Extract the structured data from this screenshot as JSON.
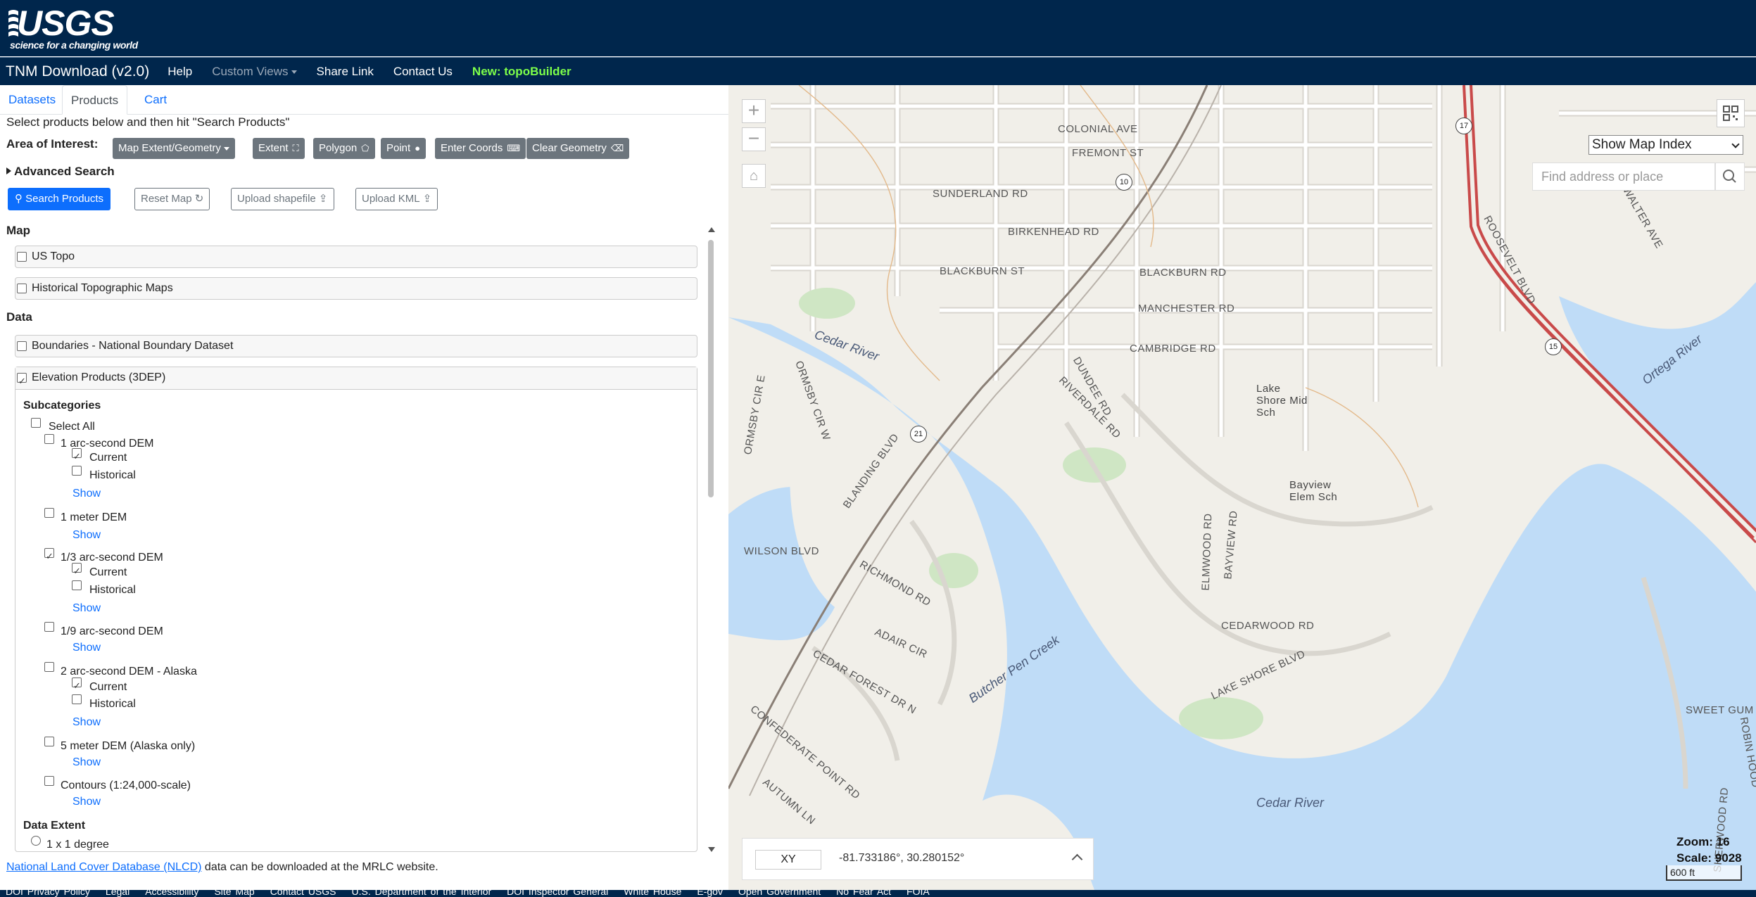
{
  "header": {
    "logo_word": "USGS",
    "logo_tagline": "science for a changing world",
    "app_title": "TNM Download (v2.0)",
    "nav": {
      "help": "Help",
      "custom_views": "Custom Views",
      "share_link": "Share Link",
      "contact_us": "Contact Us",
      "topobuilder": "New: topoBuilder"
    }
  },
  "tabs": [
    "Datasets",
    "Products",
    "Cart"
  ],
  "instructions": "Select products below and then hit \"Search Products\"",
  "aoi": {
    "label": "Area of Interest:",
    "dropdown": "Map Extent/Geometry",
    "extent": "Extent",
    "polygon": "Polygon",
    "point": "Point",
    "enter_coords": "Enter Coords",
    "clear_geometry": "Clear Geometry"
  },
  "advanced_search": "Advanced Search",
  "actions": {
    "search_products": "Search Products",
    "reset_map": "Reset Map",
    "upload_shapefile": "Upload shapefile",
    "upload_kml": "Upload KML"
  },
  "sections": {
    "map": "Map",
    "data": "Data",
    "us_topo": "US Topo",
    "historical_topo": "Historical Topographic Maps",
    "boundaries": "Boundaries - National Boundary Dataset",
    "elevation": "Elevation Products (3DEP)",
    "subcategories": "Subcategories",
    "select_all": "Select All",
    "data_extent": "Data Extent",
    "extent_option": "1 x 1 degree"
  },
  "products": [
    {
      "name": "1 arc-second DEM",
      "checked": false,
      "current": true,
      "historical": false,
      "show": "Show"
    },
    {
      "name": "1 meter DEM",
      "checked": false,
      "show": "Show"
    },
    {
      "name": "1/3 arc-second DEM",
      "checked": true,
      "current": true,
      "historical": false,
      "show": "Show"
    },
    {
      "name": "1/9 arc-second DEM",
      "checked": false,
      "show": "Show"
    },
    {
      "name": "2 arc-second DEM - Alaska",
      "checked": false,
      "current": true,
      "historical": false,
      "show": "Show"
    },
    {
      "name": "5 meter DEM (Alaska only)",
      "checked": false,
      "show": "Show"
    },
    {
      "name": "Contours (1:24,000-scale)",
      "checked": false,
      "show": "Show"
    }
  ],
  "labels": {
    "current": "Current",
    "historical": "Historical"
  },
  "footer_note": {
    "link": "National Land Cover Database (NLCD)",
    "text": " data can be downloaded at the MRLC website."
  },
  "footer_links": [
    "DOI Privacy Policy",
    "Legal",
    "Accessibility",
    "Site Map",
    "Contact USGS",
    "U.S. Department of the Interior",
    "DOI Inspector General",
    "White House",
    "E-gov",
    "Open Government",
    "No Fear Act",
    "FOIA"
  ],
  "map": {
    "index_select": "Show Map Index",
    "search_placeholder": "Find address or place",
    "coord_mode": "XY",
    "coords": "-81.733186°, 30.280152°",
    "zoom": "Zoom: 16",
    "scale": "Scale: 9028",
    "scalebar": "600 ft",
    "streets": [
      "COLONIAL AVE",
      "FREMONT ST",
      "SUNDERLAND RD",
      "BIRKENHEAD RD",
      "BLACKBURN ST",
      "BLACKBURN RD",
      "MANCHESTER RD",
      "CAMBRIDGE RD",
      "DUNDEE RD",
      "RIVERDALE RD",
      "ROOSEVELT BLVD",
      "WALTER AVE",
      "BLANDING BLVD",
      "WILSON BLVD",
      "RICHMOND RD",
      "ADAIR CIR",
      "CEDAR FOREST DR N",
      "CONFEDERATE POINT RD",
      "AUTUMN LN",
      "ELMWOOD RD",
      "BAYVIEW RD",
      "CEDARWOOD RD",
      "LAKE SHORE BLVD",
      "ORMSBY CIR W",
      "ORMSBY CIR E",
      "SWEET GUM LN",
      "ROBIN HOOD",
      "SHERWOOD RD"
    ],
    "places": [
      "Lake Shore Mid Sch",
      "Bayview Elem Sch"
    ],
    "waters": [
      "Cedar River",
      "Ortega River",
      "Butcher Pen Creek",
      "Cedar River"
    ],
    "shields": [
      "17",
      "15",
      "21",
      "10"
    ]
  },
  "colors": {
    "navy": "#00264c",
    "primary": "#0d6efd",
    "secondary": "#6c757d",
    "water": "#bfdcf7",
    "topobuilder": "#7dff4a"
  }
}
